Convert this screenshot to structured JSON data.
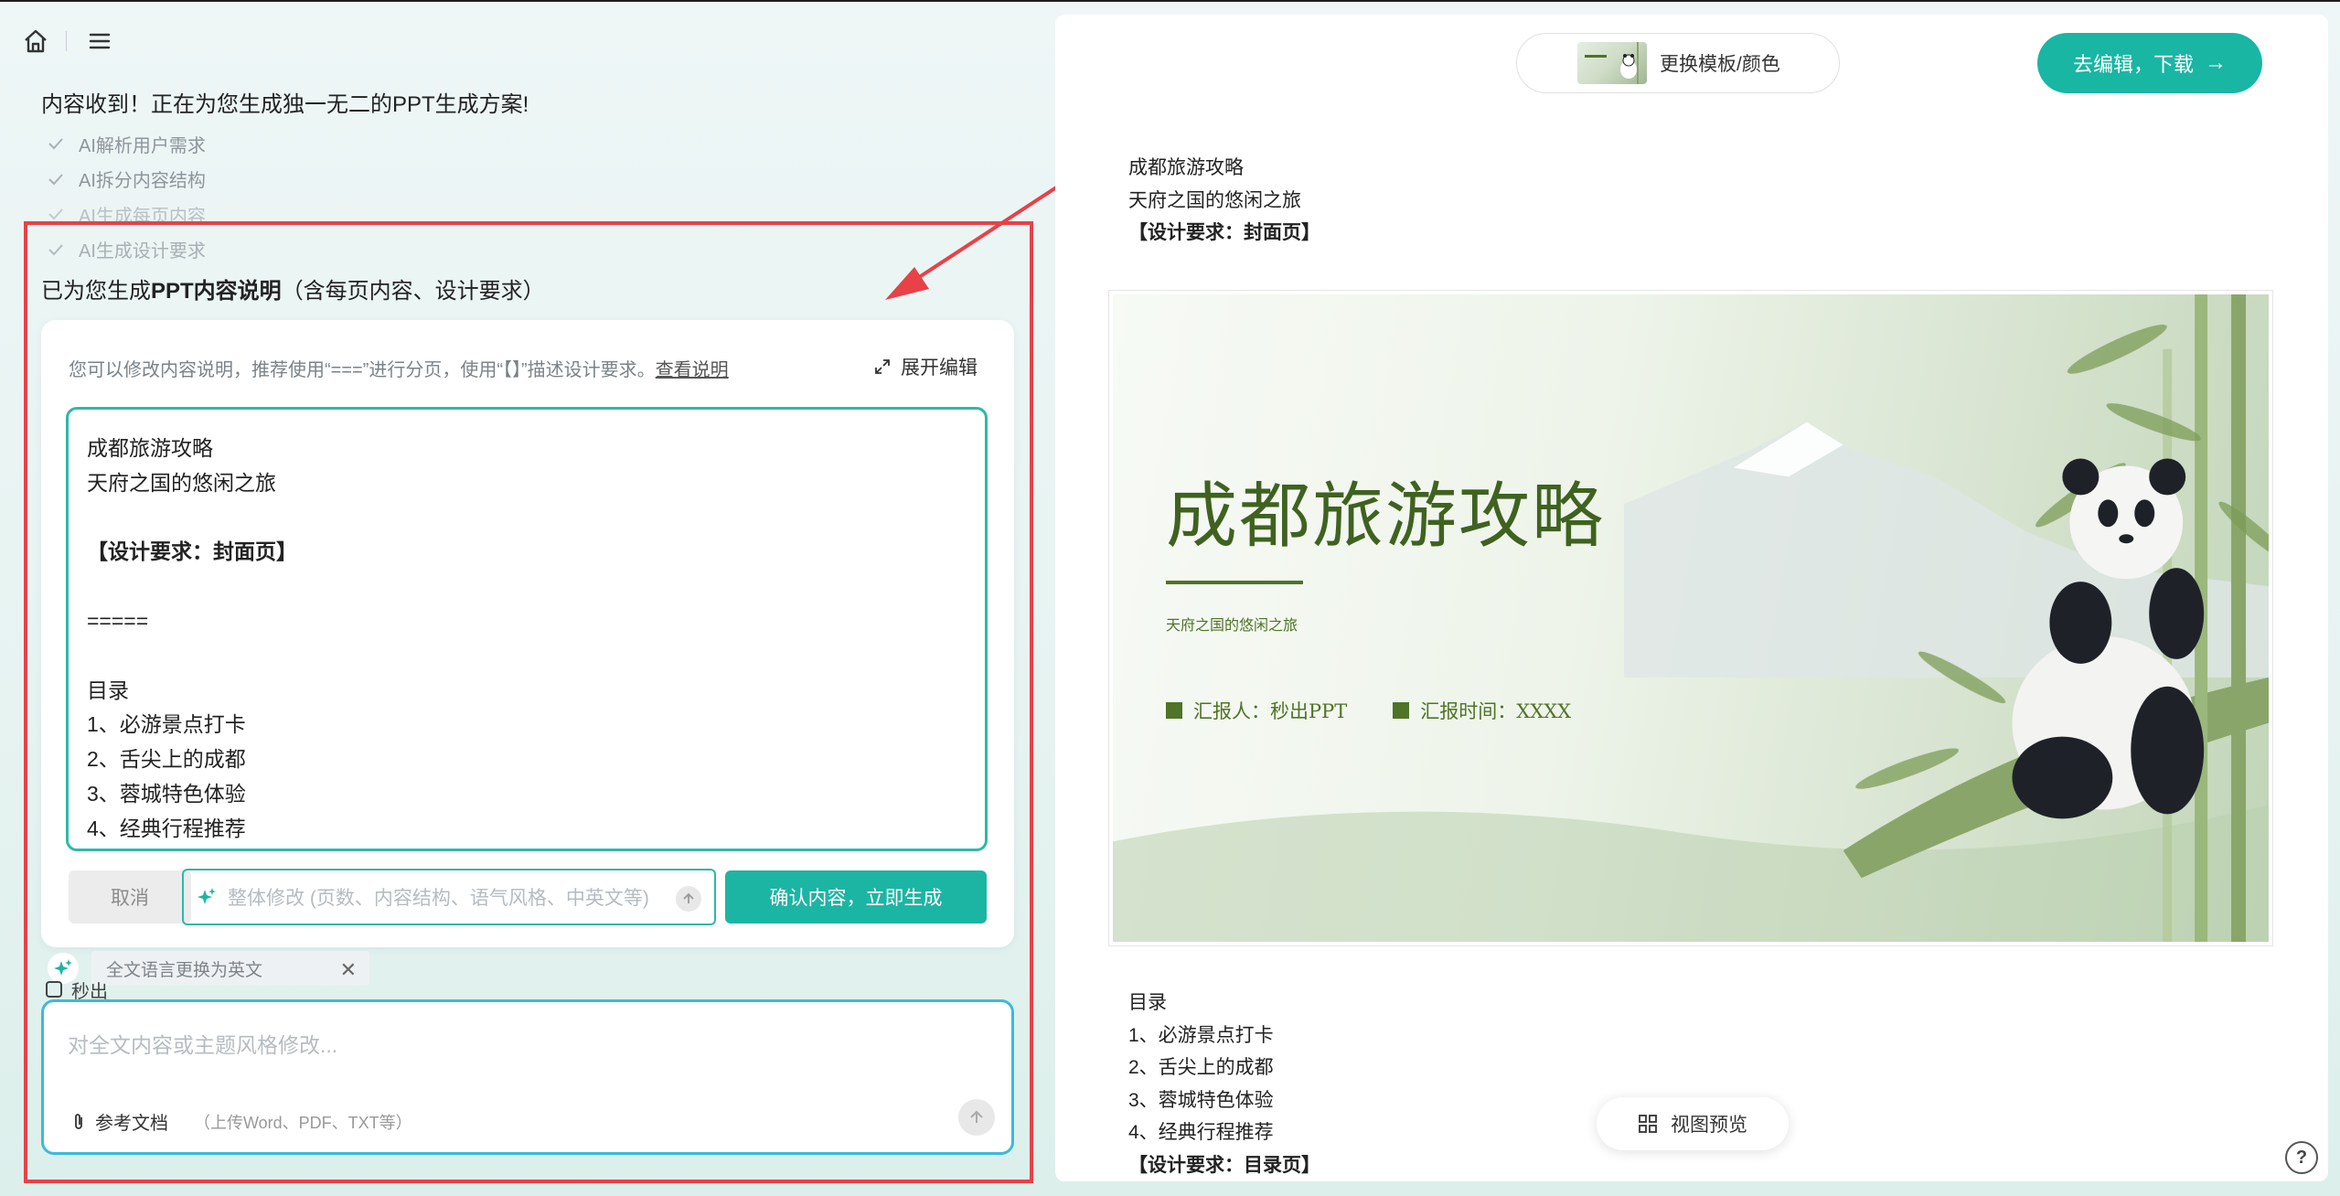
{
  "left": {
    "intro": "内容收到！正在为您生成独一无二的PPT生成方案!",
    "steps": [
      "AI解析用户需求",
      "AI拆分内容结构",
      "AI生成每页内容",
      "AI生成设计要求"
    ],
    "generated_prefix": "已为您生成",
    "generated_bold": "PPT内容说明",
    "generated_suffix": "（含每页内容、设计要求）",
    "card": {
      "hint": "您可以修改内容说明，推荐使用“===”进行分页，使用“【】”描述设计要求。",
      "hint_link": "查看说明",
      "expand_label": "展开编辑",
      "editor_lines": [
        "成都旅游攻略",
        "天府之国的悠闲之旅",
        "",
        "【设计要求：封面页】",
        "",
        "=====",
        "",
        "目录",
        "1、必游景点打卡",
        "2、舌尖上的成都",
        "3、蓉城特色体验",
        "4、经典行程推荐"
      ],
      "cancel_label": "取消",
      "mini_placeholder": "整体修改 (页数、内容结构、语气风格、中英文等)",
      "confirm_label": "确认内容，立即生成"
    },
    "chip_label": "全文语言更换为英文",
    "peek_label": "秒出",
    "chat": {
      "placeholder": "对全文内容或主题风格修改...",
      "attach_label": "参考文档",
      "attach_hint": "（上传Word、PDF、TXT等）"
    }
  },
  "right": {
    "template_label": "更换模板/颜色",
    "go_label": "去编辑，下载",
    "doc_top": [
      "成都旅游攻略",
      "天府之国的悠闲之旅",
      "【设计要求：封面页】"
    ],
    "slide": {
      "title": "成都旅游攻略",
      "subtitle": "天府之国的悠闲之旅",
      "reporter": "汇报人：秒出PPT",
      "report_time": "汇报时间：XXXX"
    },
    "doc_bottom": [
      "目录",
      "1、必游景点打卡",
      "2、舌尖上的成都",
      "3、蓉城特色体验",
      "4、经典行程推荐",
      "【设计要求：目录页】"
    ],
    "preview_label": "视图预览",
    "help_label": "?"
  },
  "colors": {
    "accent": "#1cb5a3",
    "highlight": "#e84148",
    "slide_green": "#4f7327"
  }
}
